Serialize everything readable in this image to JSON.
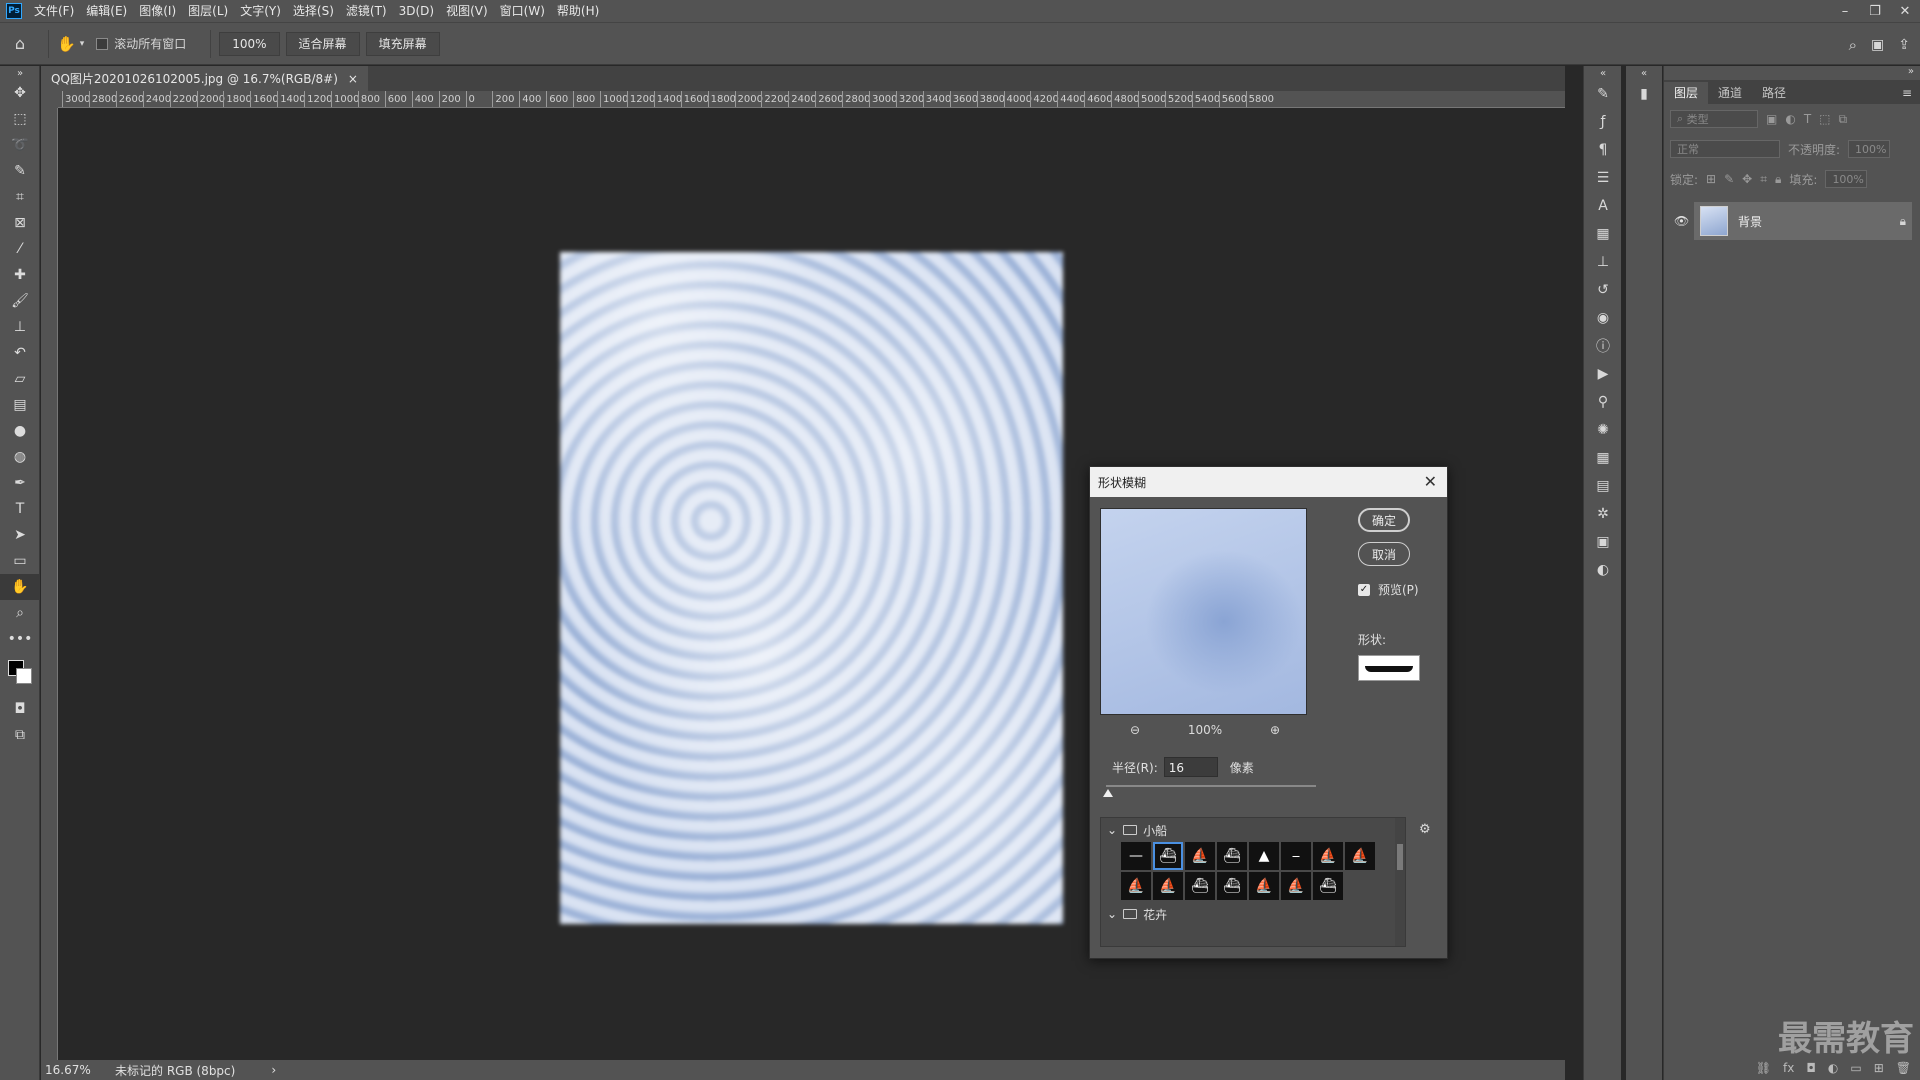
{
  "menubar": {
    "logo": "Ps",
    "items": [
      "文件(F)",
      "编辑(E)",
      "图像(I)",
      "图层(L)",
      "文字(Y)",
      "选择(S)",
      "滤镜(T)",
      "3D(D)",
      "视图(V)",
      "窗口(W)",
      "帮助(H)"
    ]
  },
  "optbar": {
    "scroll_all_label": "滚动所有窗口",
    "zoom_label": "100%",
    "fit_screen_label": "适合屏幕",
    "fill_screen_label": "填充屏幕"
  },
  "document": {
    "tab_title": "QQ图片20201026102005.jpg @ 16.7%(RGB/8#)",
    "tab_close": "×"
  },
  "ruler": {
    "top_ticks": [
      "3000",
      "2800",
      "2600",
      "2400",
      "2200",
      "2000",
      "1800",
      "1600",
      "1400",
      "1200",
      "1000",
      "800",
      "600",
      "400",
      "200",
      "0",
      "200",
      "400",
      "600",
      "800",
      "1000",
      "1200",
      "1400",
      "1600",
      "1800",
      "2000",
      "2200",
      "2400",
      "2600",
      "2800",
      "3000",
      "3200",
      "3400",
      "3600",
      "3800",
      "4000",
      "4200",
      "4400",
      "4600",
      "4800",
      "5000",
      "5200",
      "5400",
      "5600",
      "5800"
    ]
  },
  "status": {
    "zoom": "16.67%",
    "color_profile": "未标记的 RGB (8bpc)",
    "arrow": "›"
  },
  "layers_panel": {
    "tabs": [
      "图层",
      "通道",
      "路径"
    ],
    "filter_placeholder": "类型",
    "blend_mode": "正常",
    "opacity_label": "不透明度:",
    "opacity_value": "100%",
    "lock_label": "锁定:",
    "fill_label": "填充:",
    "fill_value": "100%",
    "layer_name": "背景",
    "watermark": "最需教育"
  },
  "dialog": {
    "title": "形状模糊",
    "ok_label": "确定",
    "cancel_label": "取消",
    "preview_label": "预览(P)",
    "preview_checked": true,
    "zoom_value": "100%",
    "shape_label": "形状:",
    "radius_label": "半径(R):",
    "radius_value": "16",
    "unit_label": "像素",
    "slider_fraction": 0.0,
    "groups": [
      {
        "name": "小船",
        "expanded": true
      },
      {
        "name": "花卉",
        "expanded": true
      }
    ],
    "selected_shape_index": 1
  },
  "colors": {
    "panel_bg": "#535353",
    "canvas_bg": "#282828",
    "selection_blue": "#4a90e2"
  }
}
